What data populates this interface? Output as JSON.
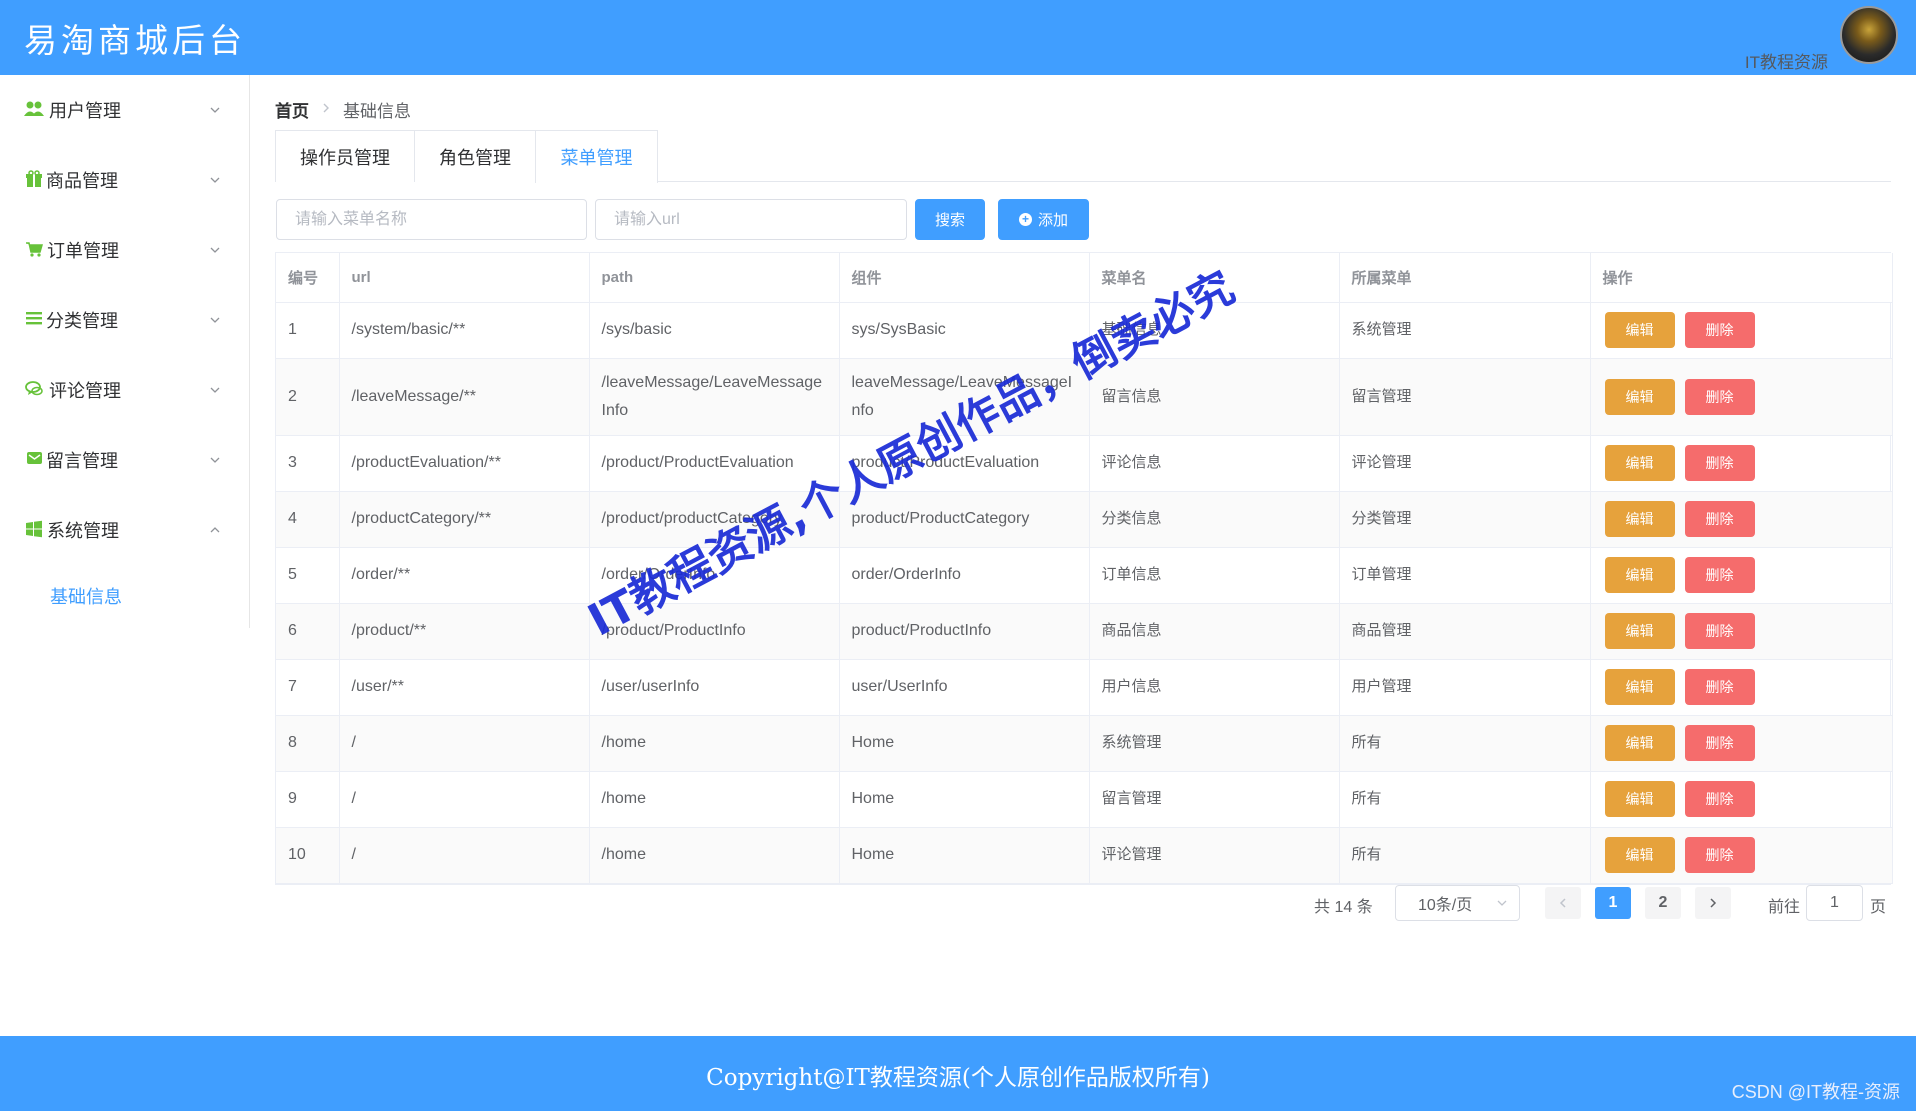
{
  "header": {
    "brand": "易淘商城后台",
    "user_name": "IT教程资源"
  },
  "sidebar": {
    "items": [
      {
        "label": "用户管理",
        "icon": "users-icon"
      },
      {
        "label": "商品管理",
        "icon": "gift-icon"
      },
      {
        "label": "订单管理",
        "icon": "cart-icon"
      },
      {
        "label": "分类管理",
        "icon": "list-icon"
      },
      {
        "label": "评论管理",
        "icon": "comments-icon"
      },
      {
        "label": "留言管理",
        "icon": "envelope-icon"
      },
      {
        "label": "系统管理",
        "icon": "windows-icon"
      }
    ],
    "sub_item": "基础信息"
  },
  "breadcrumb": {
    "home": "首页",
    "current": "基础信息"
  },
  "tabs": [
    "操作员管理",
    "角色管理",
    "菜单管理"
  ],
  "search": {
    "name_placeholder": "请输入菜单名称",
    "url_placeholder": "请输入url",
    "search_label": "搜索",
    "add_label": "添加"
  },
  "table": {
    "headers": [
      "编号",
      "url",
      "path",
      "组件",
      "菜单名",
      "所属菜单",
      "操作"
    ],
    "edit_label": "编辑",
    "delete_label": "删除",
    "rows": [
      {
        "id": "1",
        "url": "/system/basic/**",
        "path": "/sys/basic",
        "component": "sys/SysBasic",
        "name": "基础信息",
        "parent": "系统管理"
      },
      {
        "id": "2",
        "url": "/leaveMessage/**",
        "path": "/leaveMessage/LeaveMessageInfo",
        "component": "leaveMessage/LeaveMessageInfo",
        "name": "留言信息",
        "parent": "留言管理"
      },
      {
        "id": "3",
        "url": "/productEvaluation/**",
        "path": "/product/ProductEvaluation",
        "component": "product/ProductEvaluation",
        "name": "评论信息",
        "parent": "评论管理"
      },
      {
        "id": "4",
        "url": "/productCategory/**",
        "path": "/product/productCategory",
        "component": "product/ProductCategory",
        "name": "分类信息",
        "parent": "分类管理"
      },
      {
        "id": "5",
        "url": "/order/**",
        "path": "/order/OrderInfo",
        "component": "order/OrderInfo",
        "name": "订单信息",
        "parent": "订单管理"
      },
      {
        "id": "6",
        "url": "/product/**",
        "path": "/product/ProductInfo",
        "component": "product/ProductInfo",
        "name": "商品信息",
        "parent": "商品管理"
      },
      {
        "id": "7",
        "url": "/user/**",
        "path": "/user/userInfo",
        "component": "user/UserInfo",
        "name": "用户信息",
        "parent": "用户管理"
      },
      {
        "id": "8",
        "url": "/",
        "path": "/home",
        "component": "Home",
        "name": "系统管理",
        "parent": "所有"
      },
      {
        "id": "9",
        "url": "/",
        "path": "/home",
        "component": "Home",
        "name": "留言管理",
        "parent": "所有"
      },
      {
        "id": "10",
        "url": "/",
        "path": "/home",
        "component": "Home",
        "name": "评论管理",
        "parent": "所有"
      }
    ]
  },
  "pagination": {
    "total": "共 14 条",
    "page_size": "10条/页",
    "pages": [
      "1",
      "2"
    ],
    "goto_label": "前往",
    "goto_value": "1",
    "page_suffix": "页"
  },
  "watermark": "IT教程资源,个人原创作品，倒卖必究",
  "footer": {
    "copyright": "Copyright@IT教程资源(个人原创作品版权所有)",
    "csdn": "CSDN @IT教程-资源"
  },
  "colors": {
    "primary": "#409eff",
    "warning": "#e6a23c",
    "danger": "#f56c6c",
    "menu_icon": "#67c23a"
  }
}
